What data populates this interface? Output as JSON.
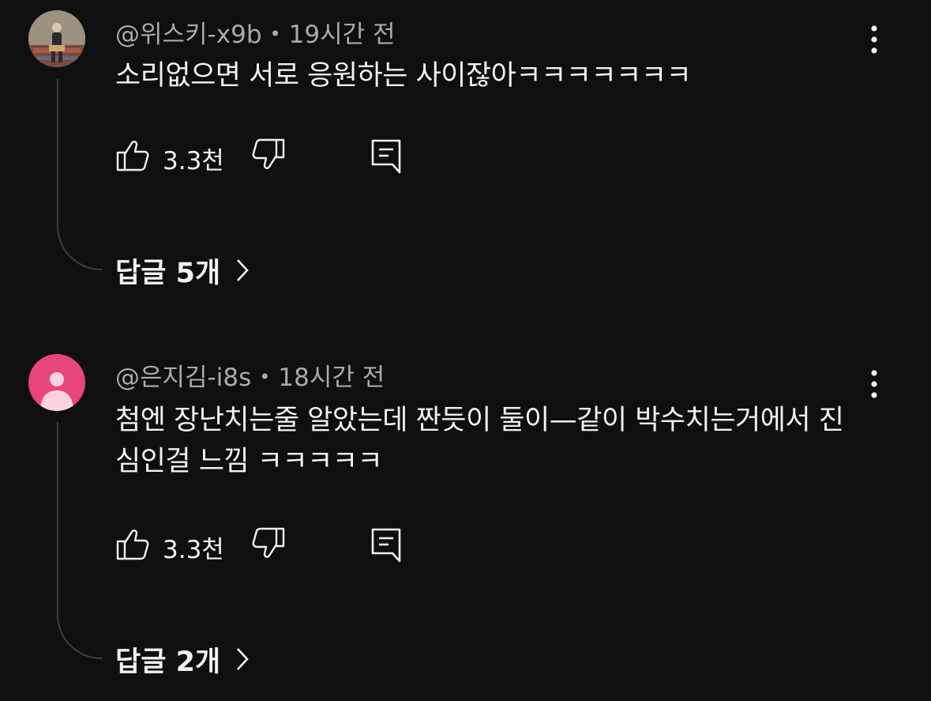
{
  "comments": [
    {
      "author": "@위스키-x9b",
      "time": "19시간 전",
      "text": "소리없으면 서로 응원하는 사이잖아ㅋㅋㅋㅋㅋㅋㅋ",
      "likes": "3.3천",
      "replies_label": "답글 5개",
      "avatar": "photo-avatar"
    },
    {
      "author": "@은지김-i8s",
      "time": "18시간 전",
      "text": "첨엔 장난치는줄 알았는데 짠듯이 둘이—같이 박수치는거에서 진심인걸 느낌 ㅋㅋㅋㅋㅋ",
      "likes": "3.3천",
      "replies_label": "답글 2개",
      "avatar": "default-person-avatar"
    }
  ],
  "icons": {
    "like": "thumbs-up-icon",
    "dislike": "thumbs-down-icon",
    "reply": "reply-comment-icon",
    "more": "more-vert-icon",
    "expand": "chevron-right-icon"
  },
  "colors": {
    "background": "#0f0f0f",
    "text_primary": "#f1f1f1",
    "text_secondary": "#aaaaaa",
    "thread_line": "#3d3d3d",
    "default_avatar": "#e8457a"
  }
}
